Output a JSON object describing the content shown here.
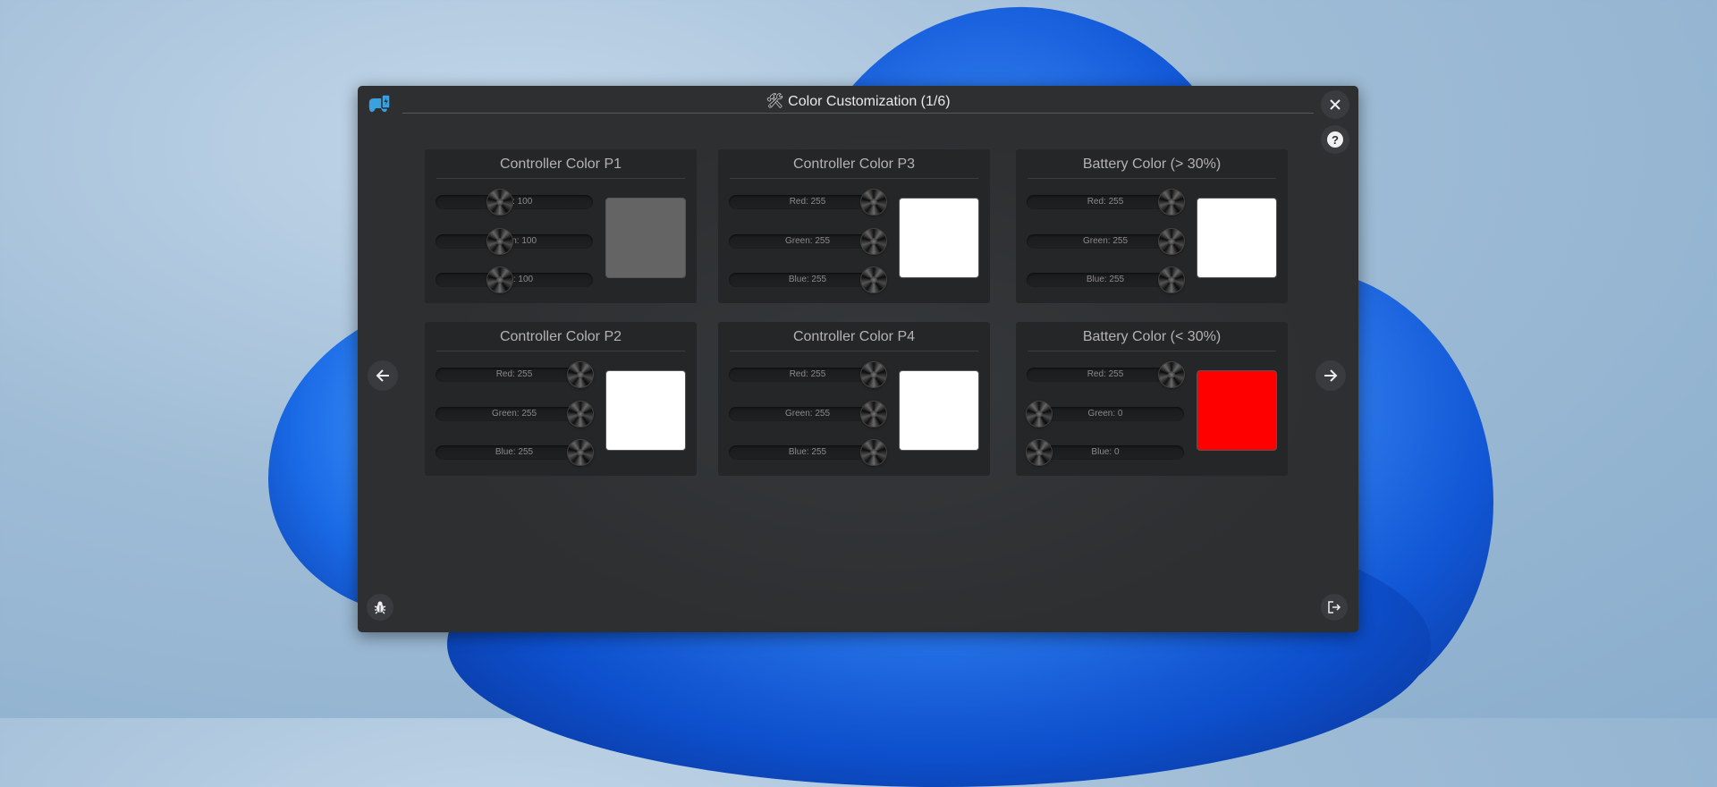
{
  "window": {
    "title": "🛠 Color Customization (1/6)"
  },
  "panels": [
    {
      "title": "Controller Color P1",
      "swatch_color": "#646464",
      "sliders": [
        {
          "label": "Red: 100",
          "value": 100
        },
        {
          "label": "Green: 100",
          "value": 100
        },
        {
          "label": "Blue: 100",
          "value": 100
        }
      ]
    },
    {
      "title": "Controller Color P3",
      "swatch_color": "#ffffff",
      "sliders": [
        {
          "label": "Red: 255",
          "value": 255
        },
        {
          "label": "Green: 255",
          "value": 255
        },
        {
          "label": "Blue: 255",
          "value": 255
        }
      ]
    },
    {
      "title": "Battery Color (> 30%)",
      "swatch_color": "#ffffff",
      "sliders": [
        {
          "label": "Red: 255",
          "value": 255
        },
        {
          "label": "Green: 255",
          "value": 255
        },
        {
          "label": "Blue: 255",
          "value": 255
        }
      ]
    },
    {
      "title": "Controller Color P2",
      "swatch_color": "#ffffff",
      "sliders": [
        {
          "label": "Red: 255",
          "value": 255
        },
        {
          "label": "Green: 255",
          "value": 255
        },
        {
          "label": "Blue: 255",
          "value": 255
        }
      ]
    },
    {
      "title": "Controller Color P4",
      "swatch_color": "#ffffff",
      "sliders": [
        {
          "label": "Red: 255",
          "value": 255
        },
        {
          "label": "Green: 255",
          "value": 255
        },
        {
          "label": "Blue: 255",
          "value": 255
        }
      ]
    },
    {
      "title": "Battery Color (< 30%)",
      "swatch_color": "#ff0000",
      "sliders": [
        {
          "label": "Red: 255",
          "value": 255
        },
        {
          "label": "Green: 0",
          "value": 0
        },
        {
          "label": "Blue: 0",
          "value": 0
        }
      ]
    }
  ],
  "icons": {
    "app": "controller-battery-icon",
    "close": "close-icon",
    "help": "help-icon",
    "prev": "arrow-left-icon",
    "next": "arrow-right-icon",
    "debug": "bug-icon",
    "exit": "exit-icon"
  },
  "colors": {
    "window_bg": "#2d2f31",
    "panel_bg": "#252627",
    "accent": "#3aa0e0"
  }
}
